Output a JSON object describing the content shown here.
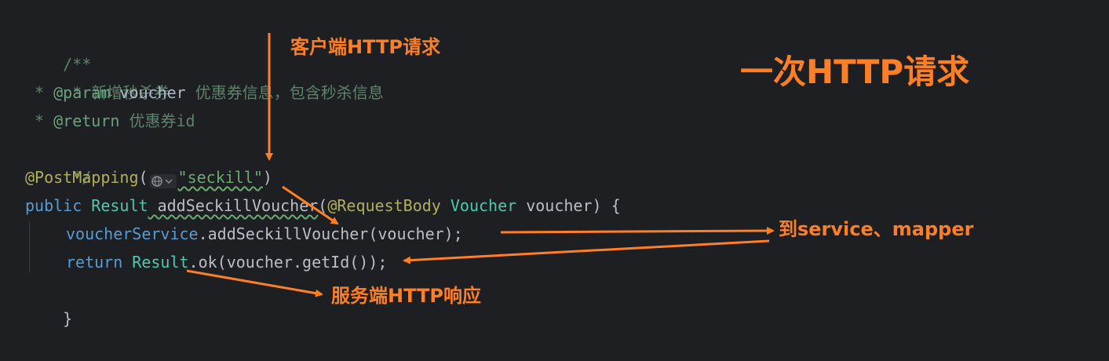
{
  "code": {
    "line1": "/**",
    "line2": " * 新增秒杀券",
    "line3_prefix": " * ",
    "line3_tag": "@param",
    "line3_param": " voucher",
    "line3_desc": " 优惠券信息，包含秒杀信息",
    "line4_prefix": " * ",
    "line4_tag": "@return",
    "line4_desc": " 优惠券id",
    "line5": " */",
    "line6_ann": "@PostMapping",
    "line6_open": "(",
    "line6_str": "\"seckill\"",
    "line6_close": ")",
    "line7_kw": "public",
    "line7_type": " Result",
    "line7_method": " addSeckillVoucher",
    "line7_open": "(",
    "line7_ann": "@RequestBody",
    "line7_ptype": " Voucher",
    "line7_rest": " voucher) {",
    "line8_obj": "voucherService",
    "line8_rest": ".addSeckillVoucher(voucher);",
    "line9_kw": "return",
    "line9_cls": " Result",
    "line9_rest": ".ok(voucher.getId());",
    "line10": "}"
  },
  "annotations": {
    "client_request": "客户端HTTP请求",
    "title": "一次HTTP请求",
    "service_mapper": "到service、mapper",
    "server_response": "服务端HTTP响应"
  },
  "icons": {
    "globe_chip": "globe-icon",
    "chevron": "chevron-down-icon"
  },
  "colors": {
    "background": "#1e1f22",
    "annotation": "#ff7f27"
  }
}
